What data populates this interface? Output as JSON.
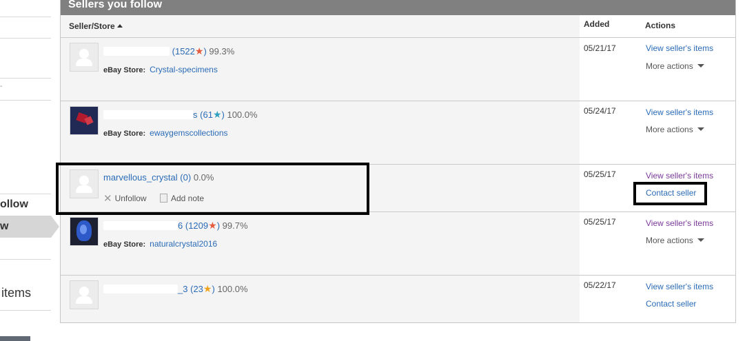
{
  "sidebar": {
    "follow_label": "ollow",
    "active_label": "w",
    "items_label": "items",
    "mark": "-"
  },
  "panel": {
    "title": "Sellers you follow",
    "columns": {
      "seller": "Seller/Store",
      "added": "Added",
      "actions": "Actions"
    }
  },
  "rows": [
    {
      "name_tail": "",
      "score": "1522",
      "star_color": "#e45a3c",
      "pct": "99.3%",
      "store_label": "eBay Store:",
      "store": "Crystal-specimens",
      "added": "05/21/17",
      "action1": "View seller's items",
      "action2": "More actions"
    },
    {
      "name_tail": "s",
      "score": "61",
      "star_color": "#2f9fbf",
      "pct": "100.0%",
      "store_label": "eBay Store:",
      "store": "ewaygemscollections",
      "added": "05/24/17",
      "action1": "View seller's items",
      "action2": "More actions"
    },
    {
      "name": "marvellous_crystal",
      "score": "0",
      "pct": "0.0%",
      "unfollow": "Unfollow",
      "add_note": "Add note",
      "added": "05/25/17",
      "action1": "View seller's items",
      "action2": "Contact seller"
    },
    {
      "name_tail": "6",
      "score": "1209",
      "star_color": "#e45a3c",
      "pct": "99.7%",
      "store_label": "eBay Store:",
      "store": "naturalcrystal2016",
      "added": "05/25/17",
      "action1": "View seller's items",
      "action2": "More actions"
    },
    {
      "name_tail": "_3",
      "score": "23",
      "star_color": "#f0a21c",
      "pct": "100.0%",
      "added": "05/22/17",
      "action1": "View seller's items",
      "action2": "Contact seller"
    }
  ]
}
